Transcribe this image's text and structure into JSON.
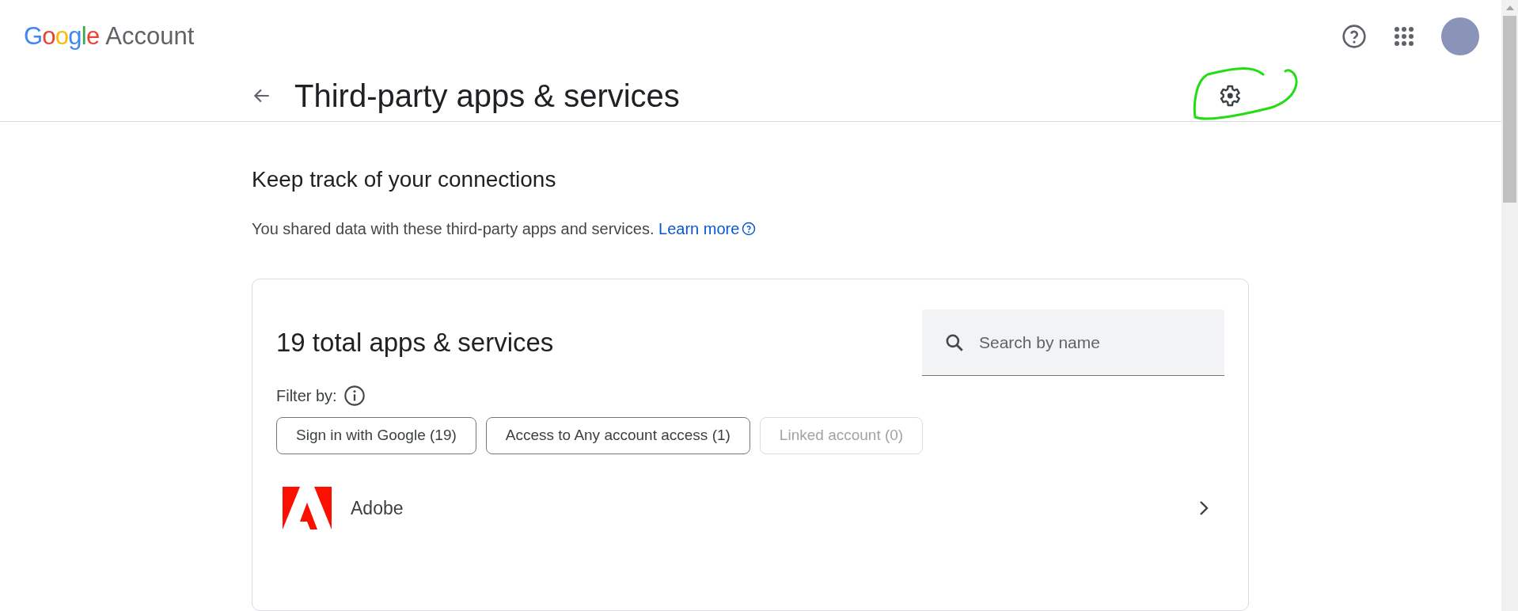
{
  "header": {
    "logo_word": "Google",
    "product": "Account"
  },
  "page": {
    "title": "Third-party apps & services"
  },
  "intro": {
    "heading": "Keep track of your connections",
    "text": "You shared data with these third-party apps and services.",
    "link": "Learn more"
  },
  "card": {
    "heading": "19 total apps & services",
    "search": {
      "placeholder": "Search by name"
    },
    "filter_label": "Filter by:",
    "filters": [
      {
        "label": "Sign in with Google (19)",
        "disabled": false
      },
      {
        "label": "Access to Any account access (1)",
        "disabled": false
      },
      {
        "label": "Linked account (0)",
        "disabled": true
      }
    ],
    "apps": [
      {
        "name": "Adobe"
      }
    ]
  }
}
